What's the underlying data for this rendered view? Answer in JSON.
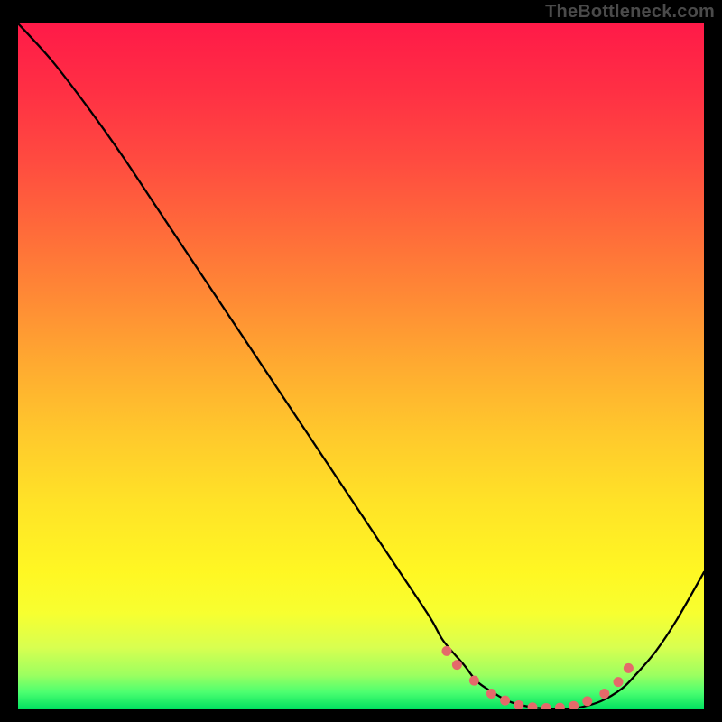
{
  "watermark": "TheBottleneck.com",
  "chart_data": {
    "type": "line",
    "title": "",
    "xlabel": "",
    "ylabel": "",
    "xlim": [
      0,
      100
    ],
    "ylim": [
      0,
      100
    ],
    "grid": false,
    "legend": false,
    "series": [
      {
        "name": "bottleneck-curve",
        "x": [
          0,
          5,
          10,
          15,
          20,
          25,
          30,
          35,
          40,
          45,
          50,
          55,
          60,
          62,
          65,
          67,
          70,
          72,
          75,
          78,
          80,
          82,
          85,
          88,
          90,
          93,
          96,
          100
        ],
        "y": [
          100,
          94.5,
          88,
          81,
          73.5,
          66,
          58.5,
          51,
          43.5,
          36,
          28.5,
          21,
          13.5,
          10,
          6.5,
          4,
          2,
          1,
          0.3,
          0.1,
          0.1,
          0.3,
          1.2,
          3,
          5,
          8.5,
          13,
          20
        ]
      }
    ],
    "markers": {
      "name": "valley-dots",
      "color": "#e46a6a",
      "x": [
        62.5,
        64,
        66.5,
        69,
        71,
        73,
        75,
        77,
        79,
        81,
        83,
        85.5,
        87.5,
        89
      ],
      "y": [
        8.5,
        6.5,
        4.2,
        2.3,
        1.3,
        0.6,
        0.3,
        0.2,
        0.25,
        0.5,
        1.2,
        2.3,
        4,
        6
      ]
    },
    "gradient_stops": [
      {
        "offset": 0.0,
        "color": "#ff1a48"
      },
      {
        "offset": 0.1,
        "color": "#ff3044"
      },
      {
        "offset": 0.2,
        "color": "#ff4b40"
      },
      {
        "offset": 0.3,
        "color": "#ff6a3a"
      },
      {
        "offset": 0.4,
        "color": "#ff8a35"
      },
      {
        "offset": 0.5,
        "color": "#ffab30"
      },
      {
        "offset": 0.6,
        "color": "#ffc92c"
      },
      {
        "offset": 0.7,
        "color": "#ffe327"
      },
      {
        "offset": 0.8,
        "color": "#fff723"
      },
      {
        "offset": 0.86,
        "color": "#f7ff30"
      },
      {
        "offset": 0.91,
        "color": "#d8ff50"
      },
      {
        "offset": 0.95,
        "color": "#9cff60"
      },
      {
        "offset": 0.975,
        "color": "#4cff70"
      },
      {
        "offset": 1.0,
        "color": "#00e060"
      }
    ]
  }
}
